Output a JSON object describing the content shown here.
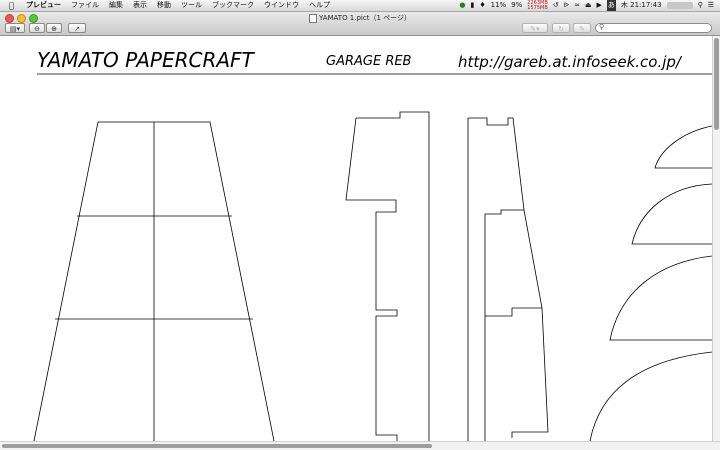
{
  "menubar": {
    "apple_icon": "apple-icon",
    "app_name": "プレビュー",
    "menus": [
      "ファイル",
      "編集",
      "表示",
      "移動",
      "ツール",
      "ブックマーク",
      "ウインドウ",
      "ヘルプ"
    ],
    "status": {
      "cpu_percent": "11%",
      "battery_percent": "9%",
      "mem_top": "2263MB",
      "mem_bottom": "1575MB",
      "clock": "木 21:17:43"
    }
  },
  "window": {
    "title": "YAMATO 1.pict（1 ページ）",
    "toolbar": {
      "zoom_out_icon": "zoom-out-icon",
      "zoom_in_icon": "zoom-in-icon",
      "share_icon": "share-icon",
      "search_placeholder": ""
    }
  },
  "document": {
    "title": "YAMATO PAPERCRAFT",
    "subtitle": "GARAGE REB",
    "url": "http://gareb.at.infoseek.co.jp/"
  }
}
